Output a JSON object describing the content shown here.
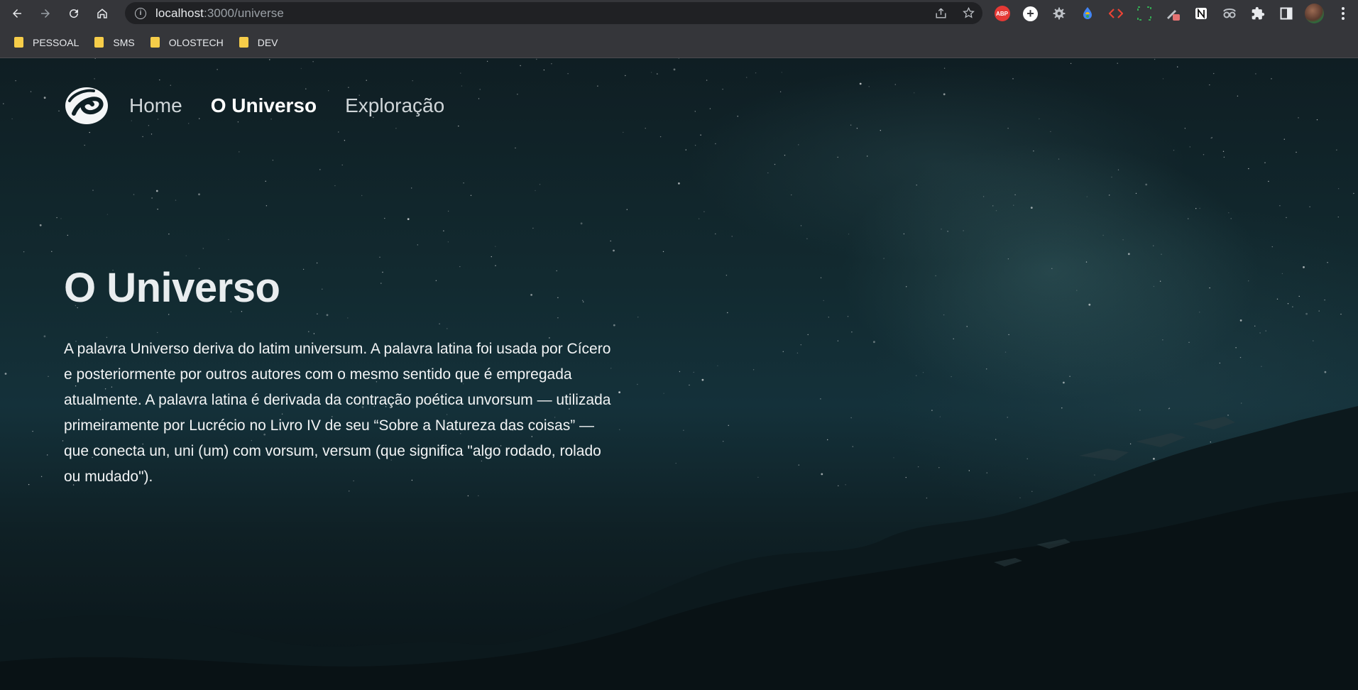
{
  "browser": {
    "url_host": "localhost",
    "url_path": ":3000/universe",
    "bookmarks": [
      {
        "label": "PESSOAL"
      },
      {
        "label": "SMS"
      },
      {
        "label": "OLOSTECH"
      },
      {
        "label": "DEV"
      }
    ],
    "extensions": [
      {
        "icon": "abp-icon",
        "text": "ABP"
      },
      {
        "icon": "add-icon"
      },
      {
        "icon": "gear-icon"
      },
      {
        "icon": "colorful-drop-icon"
      },
      {
        "icon": "code-brackets-icon"
      },
      {
        "icon": "screen-capture-icon"
      },
      {
        "icon": "eyedropper-icon"
      },
      {
        "icon": "notion-icon"
      },
      {
        "icon": "spy-glasses-icon"
      },
      {
        "icon": "puzzle-icon"
      },
      {
        "icon": "side-panel-icon"
      },
      {
        "icon": "profile-avatar"
      },
      {
        "icon": "menu-icon"
      }
    ]
  },
  "site": {
    "nav": [
      {
        "label": "Home",
        "active": false
      },
      {
        "label": "O Universo",
        "active": true
      },
      {
        "label": "Exploração",
        "active": false
      }
    ],
    "title": "O Universo",
    "body": "A palavra Universo deriva do latim universum. A palavra latina foi usada por Cícero e posteriormente por outros autores com o mesmo sentido que é empregada atualmente. A palavra latina é derivada da contração poética unvorsum — utilizada primeiramente por Lucrécio no Livro IV de seu “Sobre a Natureza das coisas” — que conecta un, uni (um) com vorsum, versum (que significa \"algo rodado, rolado ou mudado\")."
  }
}
